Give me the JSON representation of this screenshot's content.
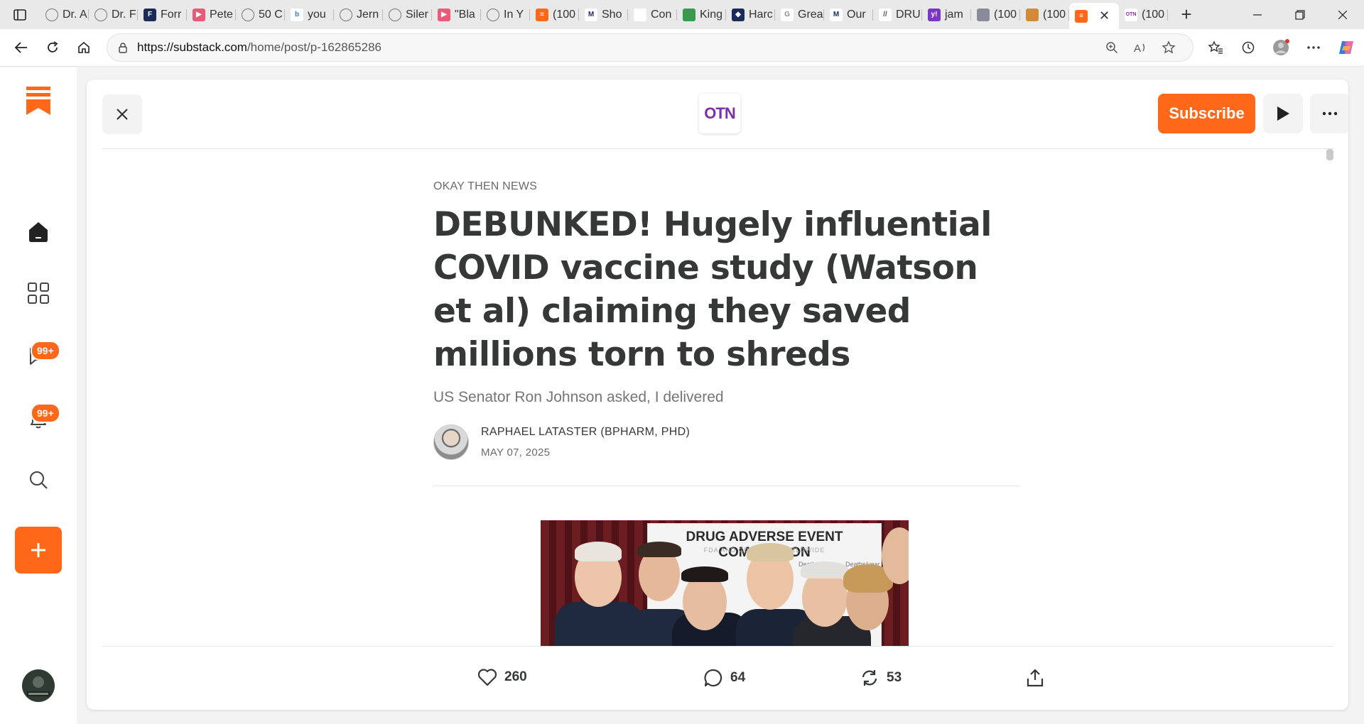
{
  "browser": {
    "tabs": [
      {
        "label": "Dr. A",
        "icon": "globe-icon"
      },
      {
        "label": "Dr. F",
        "icon": "globe-icon"
      },
      {
        "label": "Forr",
        "icon": "fox-news-icon"
      },
      {
        "label": "Pete",
        "icon": "youtube-icon"
      },
      {
        "label": "50 C",
        "icon": "globe-icon"
      },
      {
        "label": "you",
        "icon": "bing-icon"
      },
      {
        "label": "Jern",
        "icon": "globe-icon"
      },
      {
        "label": "Siler",
        "icon": "globe-icon"
      },
      {
        "label": "\"Bla",
        "icon": "youtube-icon"
      },
      {
        "label": "In Y",
        "icon": "globe-icon"
      },
      {
        "label": "(100",
        "icon": "substack-icon"
      },
      {
        "label": "Sho",
        "icon": "m-icon"
      },
      {
        "label": "Con",
        "icon": "blank-icon"
      },
      {
        "label": "King",
        "icon": "green-icon"
      },
      {
        "label": "Harc",
        "icon": "shield-icon"
      },
      {
        "label": "Grea",
        "icon": "google-icon"
      },
      {
        "label": "Our",
        "icon": "m-icon"
      },
      {
        "label": "DRU",
        "icon": "slash-icon"
      },
      {
        "label": "jam",
        "icon": "yahoo-icon"
      },
      {
        "label": "(100",
        "icon": "gray-icon"
      },
      {
        "label": "(100",
        "icon": "photo-icon"
      },
      {
        "label": "",
        "icon": "substack-icon",
        "active": true
      },
      {
        "label": "(100",
        "icon": "otn-icon"
      }
    ],
    "url_host": "https://substack.com",
    "url_path": "/home/post/p-162865286"
  },
  "rail": {
    "chat_badge": "99+",
    "notif_badge": "99+"
  },
  "post": {
    "publication_logo": "OTN",
    "subscribe_label": "Subscribe",
    "publication_name": "OKAY THEN NEWS",
    "title": "DEBUNKED! Hugely influential COVID vaccine study (Watson et al) claiming they saved millions torn to shreds",
    "subtitle": "US Senator Ron Johnson asked, I delivered",
    "author": "RAPHAEL LATASTER (BPHARM, PHD)",
    "date": "MAY 07, 2025",
    "image": {
      "board_title": "DRUG ADVERSE EVENT COMPARISON",
      "board_subtitle": "FDA AND CDC DATA WORLDWIDE",
      "col_a": "Deaths",
      "col_b": "Deaths/year"
    }
  },
  "actions": {
    "likes": "260",
    "comments": "64",
    "restacks": "53"
  },
  "colors": {
    "accent": "#ff6719",
    "text": "#363737"
  }
}
